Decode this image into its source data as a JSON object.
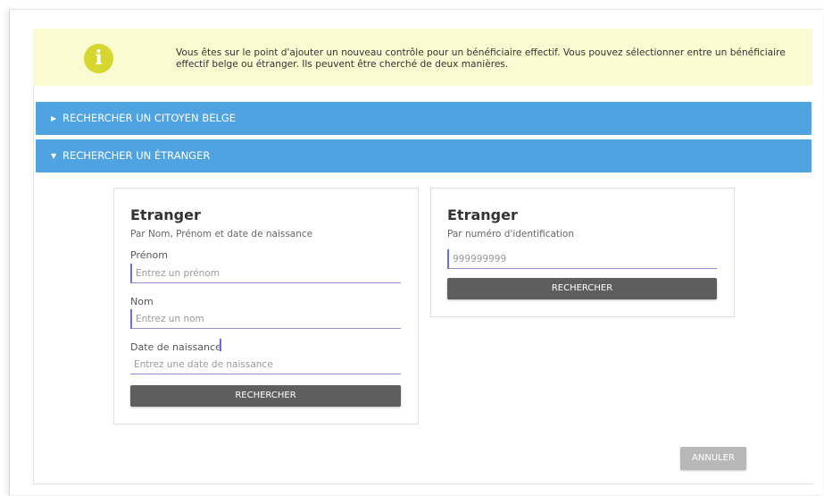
{
  "info": {
    "icon": "info-icon",
    "icon_glyph": "i",
    "message": "Vous êtes sur le point d'ajouter un nouveau contrôle pour un bénéficiaire effectif. Vous pouvez sélectionner entre un bénéficiaire effectif belge ou étranger. Ils peuvent être cherché de deux manières.",
    "background": "#fafbd0",
    "icon_color": "#d6d631"
  },
  "accordion": {
    "color": "#4fa3e0",
    "items": [
      {
        "label": "RECHERCHER UN CITOYEN BELGE",
        "expanded": false,
        "caret": "▶"
      },
      {
        "label": "RECHERCHER UN ÉTRANGER",
        "expanded": true,
        "caret": "▼"
      }
    ]
  },
  "search_by_name": {
    "title": "Etranger",
    "subtitle": "Par Nom, Prénom et date de naissance",
    "fields": [
      {
        "label": "Prénom",
        "placeholder": "Entrez un prénom",
        "value": ""
      },
      {
        "label": "Nom",
        "placeholder": "Entrez un nom",
        "value": ""
      },
      {
        "label": "Date de naissance",
        "placeholder": "Entrez une date de naissance",
        "value": ""
      }
    ],
    "button_label": "RECHERCHER"
  },
  "search_by_id": {
    "title": "Etranger",
    "subtitle": "Par numéro d'identification",
    "field": {
      "placeholder": "999999999",
      "value": ""
    },
    "button_label": "RECHERCHER"
  },
  "footer": {
    "cancel_label": "ANNULER"
  }
}
